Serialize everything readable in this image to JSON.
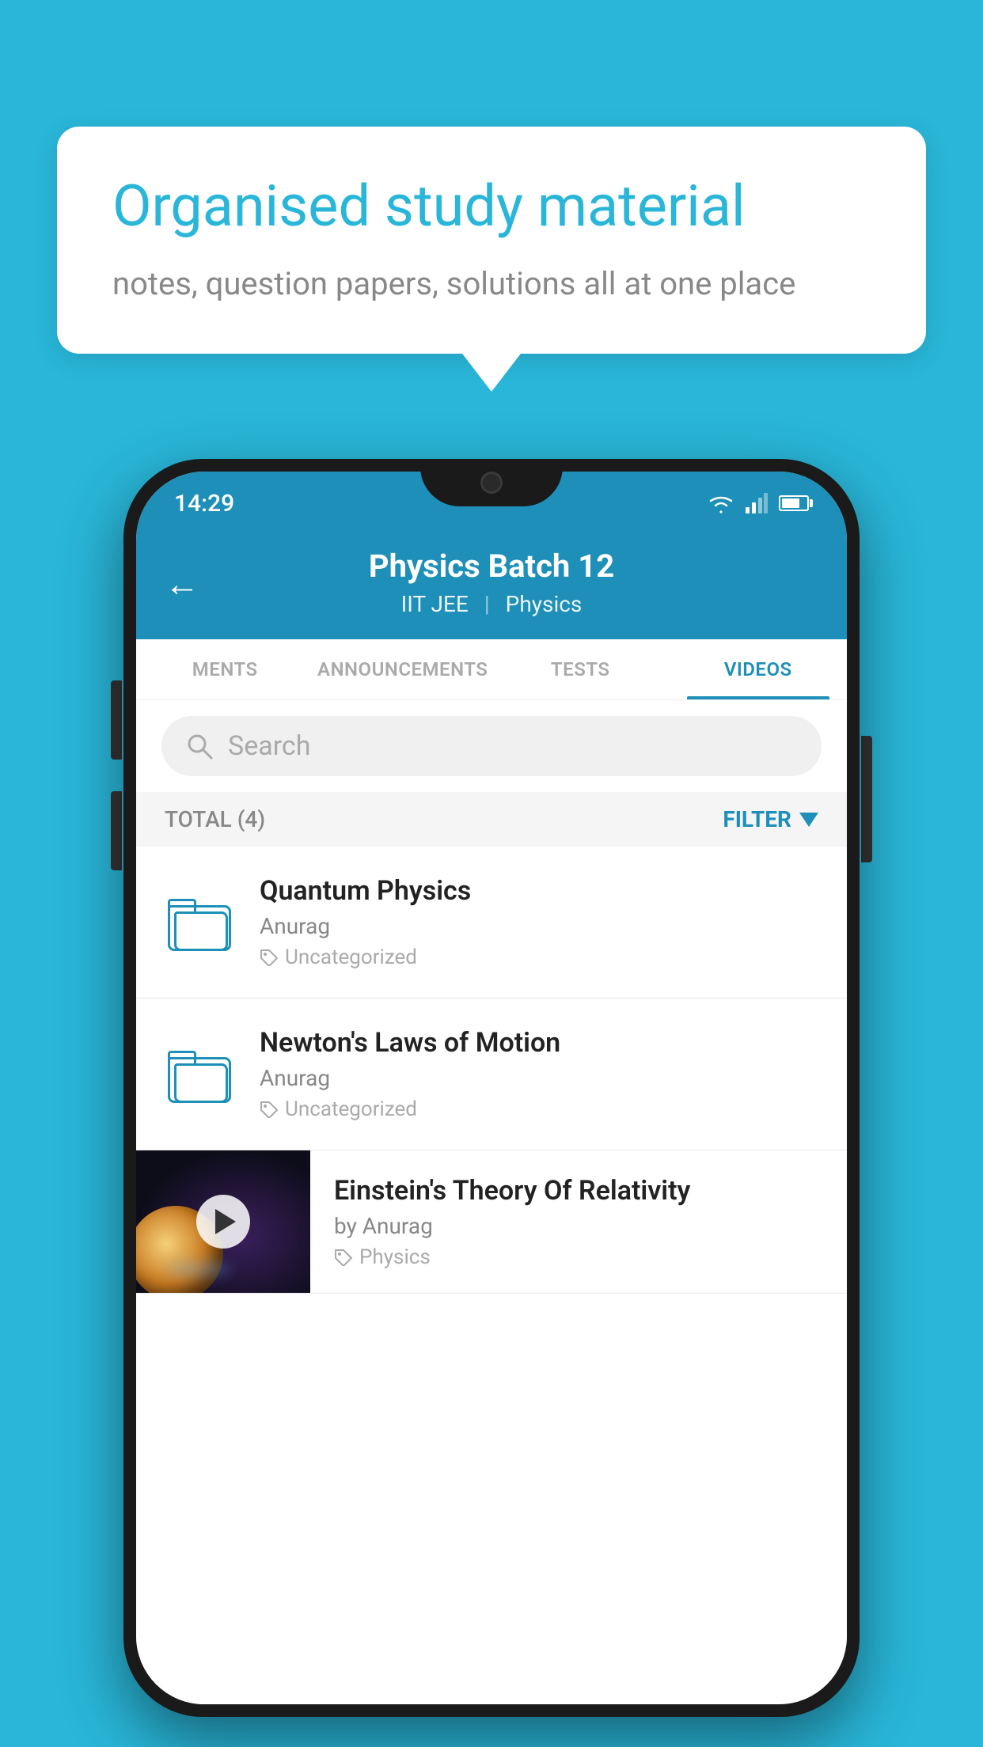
{
  "page": {
    "background_color": "#29b6d8"
  },
  "speech_bubble": {
    "title": "Organised study material",
    "subtitle": "notes, question papers, solutions all at one place"
  },
  "status_bar": {
    "time": "14:29"
  },
  "app_header": {
    "title": "Physics Batch 12",
    "tags": [
      "IIT JEE",
      "Physics"
    ],
    "back_icon": "←"
  },
  "tabs": [
    {
      "label": "MENTS",
      "active": false
    },
    {
      "label": "ANNOUNCEMENTS",
      "active": false
    },
    {
      "label": "TESTS",
      "active": false
    },
    {
      "label": "VIDEOS",
      "active": true
    }
  ],
  "search": {
    "placeholder": "Search"
  },
  "filter": {
    "total_label": "TOTAL (4)",
    "filter_label": "FILTER"
  },
  "video_items": [
    {
      "title": "Quantum Physics",
      "author": "Anurag",
      "tag": "Uncategorized",
      "has_thumbnail": false
    },
    {
      "title": "Newton's Laws of Motion",
      "author": "Anurag",
      "tag": "Uncategorized",
      "has_thumbnail": false
    },
    {
      "title": "Einstein's Theory Of Relativity",
      "author": "by Anurag",
      "tag": "Physics",
      "has_thumbnail": true
    }
  ]
}
